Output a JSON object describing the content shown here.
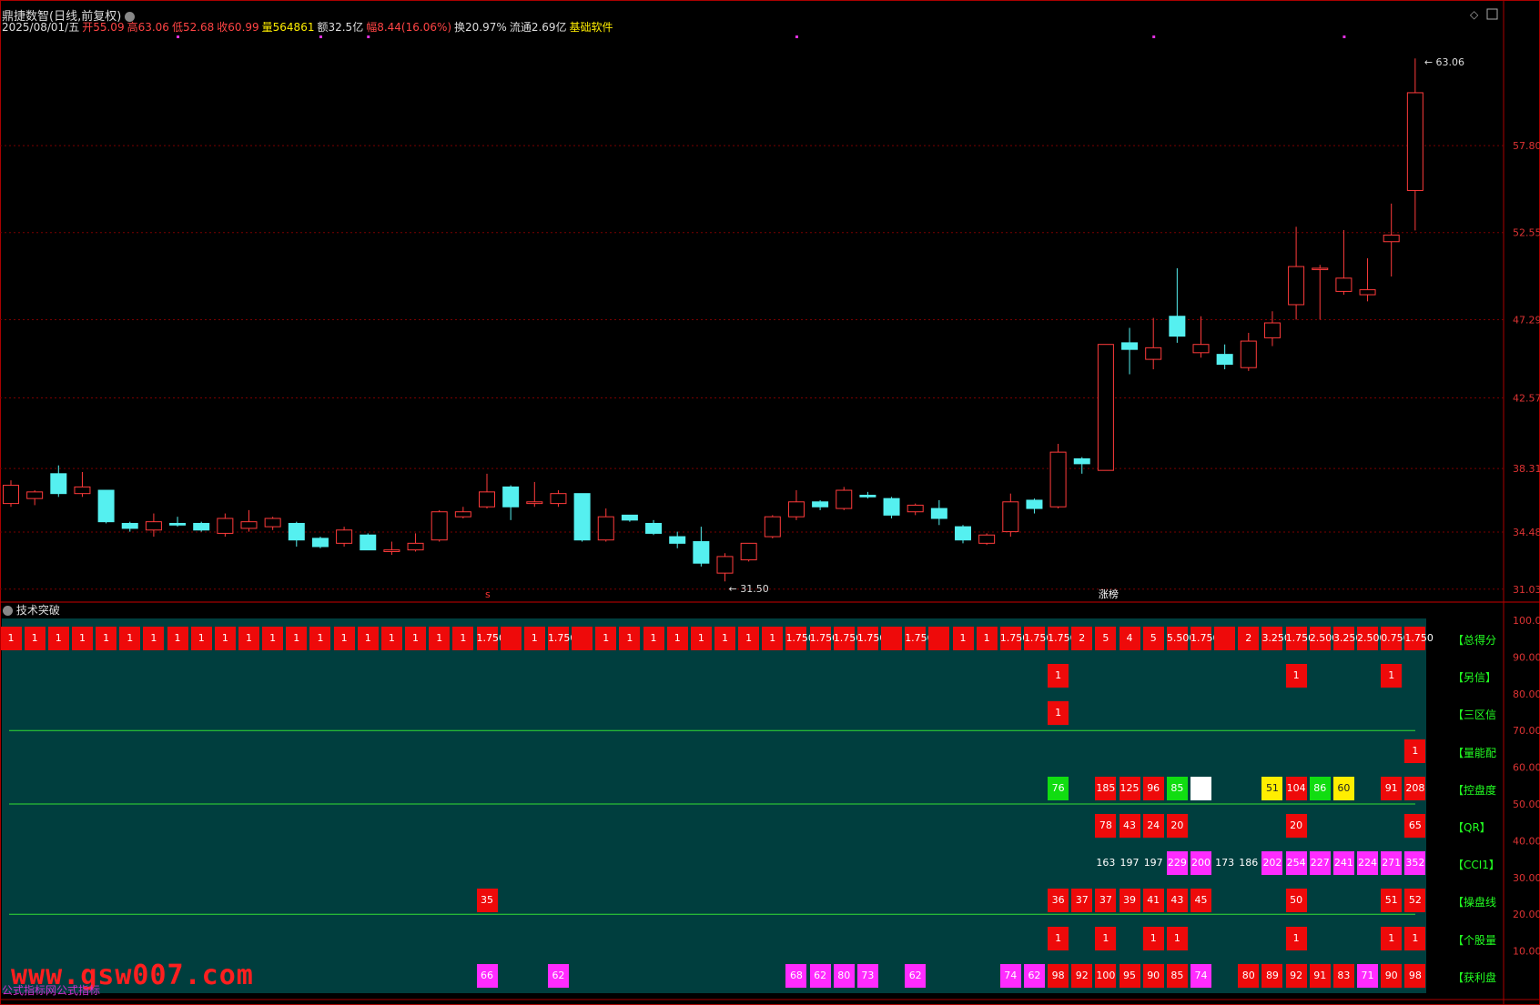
{
  "colors": {
    "up": "#ff3b3b",
    "down": "#55f0f0",
    "grid": "#7a0000",
    "teal": "#003e3e",
    "cell_red": "#ee0a0a",
    "cell_magenta": "#ff2bff",
    "cell_green": "#11dd11",
    "cell_yellow": "#ffee00",
    "cell_white": "#ffffff",
    "label_green": "#22ff22"
  },
  "header": {
    "title": "鼎捷数智(日线,前复权)",
    "line2": [
      {
        "t": "2025/08/01/五",
        "c": "#dddddd"
      },
      {
        "t": "开55.09",
        "c": "#ff4444"
      },
      {
        "t": "高63.06",
        "c": "#ff4444"
      },
      {
        "t": "低52.68",
        "c": "#ff4444"
      },
      {
        "t": "收60.99",
        "c": "#ff4444"
      },
      {
        "t": "量564861",
        "c": "#ffee00"
      },
      {
        "t": "额32.5亿",
        "c": "#dddddd"
      },
      {
        "t": "幅8.44(16.06%)",
        "c": "#ff4444"
      },
      {
        "t": "换20.97%",
        "c": "#dddddd"
      },
      {
        "t": "流通2.69亿",
        "c": "#dddddd"
      },
      {
        "t": "基础软件",
        "c": "#ffee00"
      }
    ]
  },
  "price_axis": {
    "labels": [
      "57.80",
      "52.55",
      "47.29",
      "42.57",
      "38.31",
      "34.48",
      "31.03"
    ],
    "min": 30.8,
    "max": 64.5
  },
  "annotations": {
    "high": "63.06",
    "low": "31.50",
    "mark_s": "s",
    "mark_zhangting": "涨榜"
  },
  "chart_data": {
    "type": "candlestick",
    "candles": [
      [
        36.2,
        37.3,
        37.6,
        36.0
      ],
      [
        36.5,
        36.9,
        37.0,
        36.1
      ],
      [
        38.0,
        36.8,
        38.5,
        36.6
      ],
      [
        36.8,
        37.2,
        38.1,
        36.6
      ],
      [
        37.0,
        35.1,
        37.0,
        35.0
      ],
      [
        35.0,
        34.7,
        35.1,
        34.5
      ],
      [
        34.6,
        35.1,
        35.6,
        34.2
      ],
      [
        35.0,
        34.9,
        35.4,
        34.8
      ],
      [
        35.0,
        34.6,
        35.1,
        34.5
      ],
      [
        34.4,
        35.3,
        35.6,
        34.2
      ],
      [
        34.7,
        35.1,
        35.8,
        34.5
      ],
      [
        34.8,
        35.3,
        35.4,
        34.6
      ],
      [
        35.0,
        34.0,
        35.1,
        33.6
      ],
      [
        34.1,
        33.6,
        34.2,
        33.5
      ],
      [
        33.8,
        34.6,
        34.8,
        33.6
      ],
      [
        34.3,
        33.4,
        34.4,
        33.4
      ],
      [
        33.3,
        33.4,
        33.9,
        33.1
      ],
      [
        33.4,
        33.8,
        34.4,
        33.3
      ],
      [
        34.0,
        35.7,
        35.8,
        33.9
      ],
      [
        35.4,
        35.7,
        36.0,
        35.3
      ],
      [
        36.0,
        36.9,
        38.0,
        35.9
      ],
      [
        37.2,
        36.0,
        37.3,
        35.2
      ],
      [
        36.2,
        36.3,
        37.5,
        36.0
      ],
      [
        36.2,
        36.8,
        37.0,
        36.0
      ],
      [
        36.8,
        34.0,
        36.8,
        33.9
      ],
      [
        34.0,
        35.4,
        35.9,
        33.9
      ],
      [
        35.5,
        35.2,
        35.5,
        35.1
      ],
      [
        35.0,
        34.4,
        35.2,
        34.3
      ],
      [
        34.2,
        33.8,
        34.5,
        33.5
      ],
      [
        33.9,
        32.6,
        34.8,
        32.4
      ],
      [
        32.0,
        33.0,
        33.2,
        31.5
      ],
      [
        32.8,
        33.8,
        33.8,
        32.7
      ],
      [
        34.2,
        35.4,
        35.5,
        34.1
      ],
      [
        35.4,
        36.3,
        37.0,
        35.2
      ],
      [
        36.3,
        36.0,
        36.4,
        35.8
      ],
      [
        35.9,
        37.0,
        37.2,
        35.8
      ],
      [
        36.7,
        36.6,
        36.9,
        36.5
      ],
      [
        36.5,
        35.5,
        36.6,
        35.3
      ],
      [
        35.7,
        36.1,
        36.2,
        35.5
      ],
      [
        35.9,
        35.3,
        36.4,
        34.9
      ],
      [
        34.8,
        34.0,
        34.9,
        33.8
      ],
      [
        33.8,
        34.3,
        34.4,
        33.7
      ],
      [
        34.5,
        36.3,
        36.8,
        34.2
      ],
      [
        36.4,
        35.9,
        36.5,
        35.6
      ],
      [
        36.0,
        39.3,
        39.8,
        35.9
      ],
      [
        38.9,
        38.6,
        39.0,
        38.0
      ],
      [
        38.2,
        45.8,
        45.8,
        38.2
      ],
      [
        45.9,
        45.5,
        46.8,
        44.0
      ],
      [
        44.9,
        45.6,
        47.4,
        44.3
      ],
      [
        47.5,
        46.3,
        50.4,
        45.9
      ],
      [
        45.3,
        45.8,
        47.5,
        45.0
      ],
      [
        45.2,
        44.6,
        45.8,
        44.3
      ],
      [
        44.4,
        46.0,
        46.5,
        44.2
      ],
      [
        46.2,
        47.1,
        47.8,
        45.7
      ],
      [
        48.2,
        50.5,
        52.9,
        47.3
      ],
      [
        50.4,
        50.4,
        50.6,
        47.3
      ],
      [
        49.0,
        49.8,
        52.7,
        48.8
      ],
      [
        48.8,
        49.1,
        51.0,
        48.4
      ],
      [
        52.0,
        52.4,
        54.3,
        49.9
      ],
      [
        55.09,
        60.99,
        63.06,
        52.68
      ]
    ]
  },
  "indicator": {
    "title": "技术突破",
    "scale": [
      "100.0",
      "90.00",
      "80.00",
      "70.00",
      "60.00",
      "50.00",
      "40.00",
      "30.00",
      "20.00",
      "10.00"
    ],
    "rows": [
      {
        "label": "【总得分",
        "cells": [
          [
            0,
            "1",
            "r"
          ],
          [
            1,
            "1",
            "r"
          ],
          [
            2,
            "1",
            "r"
          ],
          [
            3,
            "1",
            "r"
          ],
          [
            4,
            "1",
            "r"
          ],
          [
            5,
            "1",
            "r"
          ],
          [
            6,
            "1",
            "r"
          ],
          [
            7,
            "1",
            "r"
          ],
          [
            8,
            "1",
            "r"
          ],
          [
            9,
            "1",
            "r"
          ],
          [
            10,
            "1",
            "r"
          ],
          [
            11,
            "1",
            "r"
          ],
          [
            12,
            "1",
            "r"
          ],
          [
            13,
            "1",
            "r"
          ],
          [
            14,
            "1",
            "r"
          ],
          [
            15,
            "1",
            "r"
          ],
          [
            16,
            "1",
            "r"
          ],
          [
            17,
            "1",
            "r"
          ],
          [
            18,
            "1",
            "r"
          ],
          [
            19,
            "1",
            "r"
          ],
          [
            20,
            "1.750",
            "r"
          ],
          [
            21,
            "",
            "r"
          ],
          [
            22,
            "1",
            "r"
          ],
          [
            23,
            "1.750",
            "r"
          ],
          [
            24,
            "",
            "r"
          ],
          [
            25,
            "1",
            "r"
          ],
          [
            26,
            "1",
            "r"
          ],
          [
            27,
            "1",
            "r"
          ],
          [
            28,
            "1",
            "r"
          ],
          [
            29,
            "1",
            "r"
          ],
          [
            30,
            "1",
            "r"
          ],
          [
            31,
            "1",
            "r"
          ],
          [
            32,
            "1",
            "r"
          ],
          [
            33,
            "1.750",
            "r"
          ],
          [
            34,
            "1.750",
            "r"
          ],
          [
            35,
            "1.750",
            "r"
          ],
          [
            36,
            "1.750",
            "r"
          ],
          [
            37,
            "",
            "r"
          ],
          [
            38,
            "1.750",
            "r"
          ],
          [
            39,
            "",
            "r"
          ],
          [
            40,
            "1",
            "r"
          ],
          [
            41,
            "1",
            "r"
          ],
          [
            42,
            "1.750",
            "r"
          ],
          [
            43,
            "1.750",
            "r"
          ],
          [
            44,
            "1.750",
            "r"
          ],
          [
            45,
            "2",
            "r"
          ],
          [
            46,
            "5",
            "r"
          ],
          [
            47,
            "4",
            "r"
          ],
          [
            48,
            "5",
            "r"
          ],
          [
            49,
            "5.500",
            "r"
          ],
          [
            50,
            "1.750",
            "r"
          ],
          [
            51,
            "",
            "r"
          ],
          [
            52,
            "2",
            "r"
          ],
          [
            53,
            "3.250",
            "r"
          ],
          [
            54,
            "1.750",
            "r"
          ],
          [
            55,
            "2.500",
            "r"
          ],
          [
            56,
            "3.250",
            "r"
          ],
          [
            57,
            "2.500",
            "r"
          ],
          [
            58,
            "0.750",
            "r"
          ],
          [
            59,
            "1.750",
            "r"
          ]
        ]
      },
      {
        "label": "【另信】",
        "cells": [
          [
            44,
            "1",
            "r"
          ],
          [
            54,
            "1",
            "r"
          ],
          [
            58,
            "1",
            "r"
          ]
        ]
      },
      {
        "label": "【三区信",
        "cells": [
          [
            44,
            "1",
            "r"
          ]
        ]
      },
      {
        "label": "【量能配",
        "cells": [
          [
            59,
            "1",
            "r"
          ]
        ]
      },
      {
        "label": "【控盘度",
        "cells": [
          [
            44,
            "76",
            "g"
          ],
          [
            46,
            "185",
            "r"
          ],
          [
            47,
            "125",
            "r"
          ],
          [
            48,
            "96",
            "r"
          ],
          [
            49,
            "85",
            "g"
          ],
          [
            50,
            "",
            "w"
          ],
          [
            53,
            "51",
            "y"
          ],
          [
            54,
            "104",
            "r"
          ],
          [
            55,
            "86",
            "g"
          ],
          [
            56,
            "60",
            "y"
          ],
          [
            58,
            "91",
            "r"
          ],
          [
            59,
            "208",
            "r"
          ]
        ]
      },
      {
        "label": "【QR】",
        "cells": [
          [
            46,
            "78",
            "r"
          ],
          [
            47,
            "43",
            "r"
          ],
          [
            48,
            "24",
            "r"
          ],
          [
            49,
            "20",
            "r"
          ],
          [
            54,
            "20",
            "r"
          ],
          [
            59,
            "65",
            "r"
          ]
        ]
      },
      {
        "label": "【CCI1】",
        "cells": [
          [
            46,
            "163",
            "n"
          ],
          [
            47,
            "197",
            "n"
          ],
          [
            48,
            "197",
            "n"
          ],
          [
            49,
            "229",
            "m"
          ],
          [
            50,
            "200",
            "m"
          ],
          [
            51,
            "173",
            "n"
          ],
          [
            52,
            "186",
            "n"
          ],
          [
            53,
            "202",
            "m"
          ],
          [
            54,
            "254",
            "m"
          ],
          [
            55,
            "227",
            "m"
          ],
          [
            56,
            "241",
            "m"
          ],
          [
            57,
            "224",
            "m"
          ],
          [
            58,
            "271",
            "m"
          ],
          [
            59,
            "352",
            "m"
          ]
        ]
      },
      {
        "label": "【操盘线",
        "cells": [
          [
            20,
            "35",
            "r"
          ],
          [
            44,
            "36",
            "r"
          ],
          [
            45,
            "37",
            "r"
          ],
          [
            46,
            "37",
            "r"
          ],
          [
            47,
            "39",
            "r"
          ],
          [
            48,
            "41",
            "r"
          ],
          [
            49,
            "43",
            "r"
          ],
          [
            50,
            "45",
            "r"
          ],
          [
            54,
            "50",
            "r"
          ],
          [
            58,
            "51",
            "r"
          ],
          [
            59,
            "52",
            "r"
          ]
        ]
      },
      {
        "label": "【个股量",
        "cells": [
          [
            44,
            "1",
            "r"
          ],
          [
            46,
            "1",
            "r"
          ],
          [
            48,
            "1",
            "r"
          ],
          [
            49,
            "1",
            "r"
          ],
          [
            54,
            "1",
            "r"
          ],
          [
            58,
            "1",
            "r"
          ],
          [
            59,
            "1",
            "r"
          ]
        ]
      },
      {
        "label": "【获利盘",
        "cells": [
          [
            20,
            "66",
            "m"
          ],
          [
            23,
            "62",
            "m"
          ],
          [
            33,
            "68",
            "m"
          ],
          [
            34,
            "62",
            "m"
          ],
          [
            35,
            "80",
            "m"
          ],
          [
            36,
            "73",
            "m"
          ],
          [
            38,
            "62",
            "m"
          ],
          [
            42,
            "74",
            "m"
          ],
          [
            43,
            "62",
            "m"
          ],
          [
            44,
            "98",
            "r"
          ],
          [
            45,
            "92",
            "r"
          ],
          [
            46,
            "100",
            "r"
          ],
          [
            47,
            "95",
            "r"
          ],
          [
            48,
            "90",
            "r"
          ],
          [
            49,
            "85",
            "r"
          ],
          [
            50,
            "74",
            "m"
          ],
          [
            52,
            "80",
            "r"
          ],
          [
            53,
            "89",
            "r"
          ],
          [
            54,
            "92",
            "r"
          ],
          [
            55,
            "91",
            "r"
          ],
          [
            56,
            "83",
            "r"
          ],
          [
            57,
            "71",
            "m"
          ],
          [
            58,
            "90",
            "r"
          ],
          [
            59,
            "98",
            "r"
          ]
        ]
      }
    ]
  },
  "watermark": {
    "text": "www.gsw007.com",
    "sub": "公式指标网公式指标"
  }
}
